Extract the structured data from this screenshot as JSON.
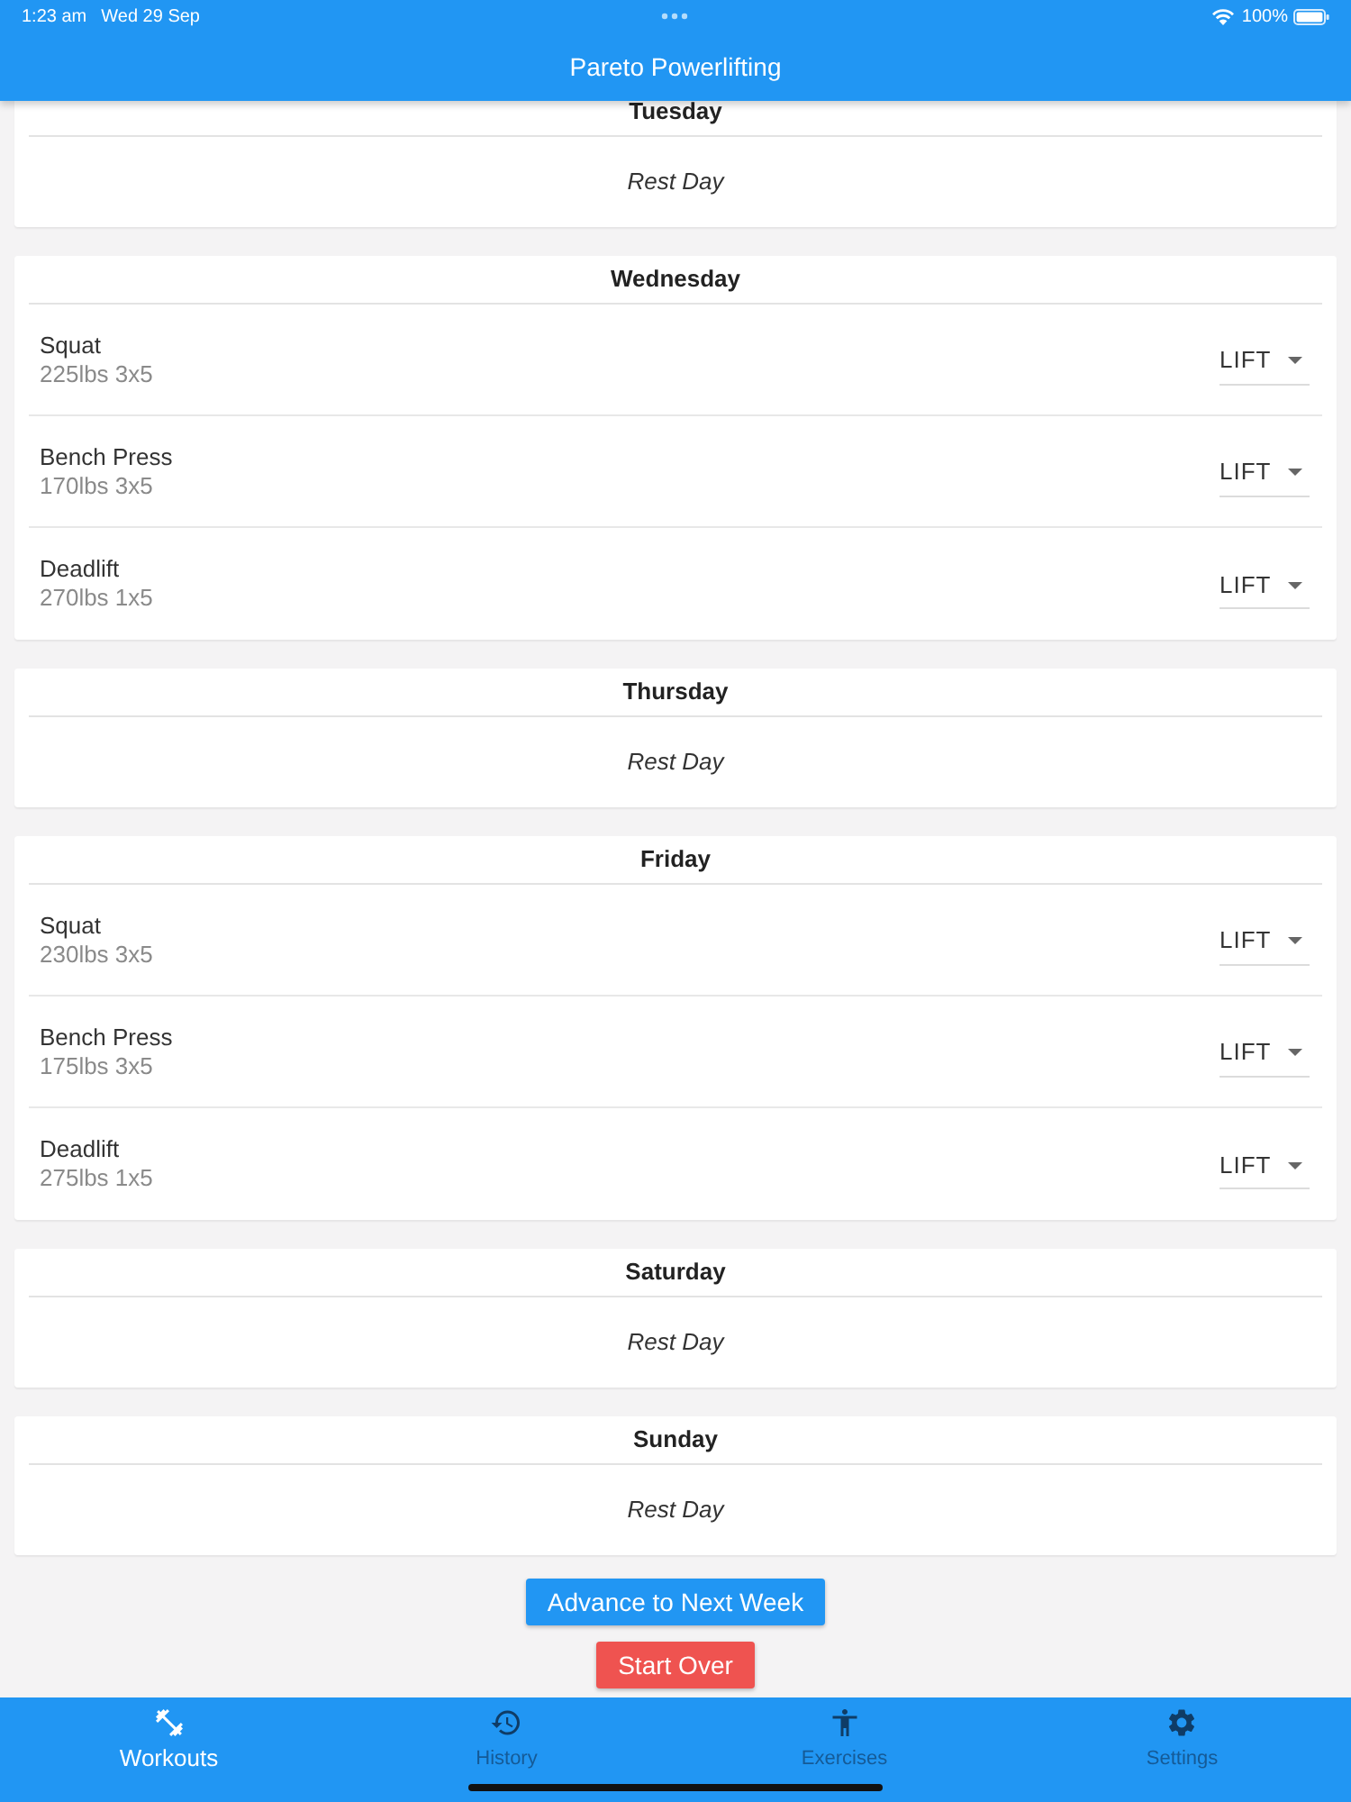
{
  "status_bar": {
    "time": "1:23 am",
    "date": "Wed 29 Sep",
    "battery": "100%"
  },
  "app_bar": {
    "title": "Pareto Powerlifting"
  },
  "days": [
    {
      "name": "Tuesday",
      "kind": "rest",
      "note": "Rest Day"
    },
    {
      "name": "Wednesday",
      "kind": "lifts",
      "exercises": [
        {
          "name": "Squat",
          "detail": "225lbs 3x5",
          "dropdown": "LIFT"
        },
        {
          "name": "Bench Press",
          "detail": "170lbs 3x5",
          "dropdown": "LIFT"
        },
        {
          "name": "Deadlift",
          "detail": "270lbs 1x5",
          "dropdown": "LIFT"
        }
      ]
    },
    {
      "name": "Thursday",
      "kind": "rest",
      "note": "Rest Day"
    },
    {
      "name": "Friday",
      "kind": "lifts",
      "exercises": [
        {
          "name": "Squat",
          "detail": "230lbs 3x5",
          "dropdown": "LIFT"
        },
        {
          "name": "Bench Press",
          "detail": "175lbs 3x5",
          "dropdown": "LIFT"
        },
        {
          "name": "Deadlift",
          "detail": "275lbs 1x5",
          "dropdown": "LIFT"
        }
      ]
    },
    {
      "name": "Saturday",
      "kind": "rest",
      "note": "Rest Day"
    },
    {
      "name": "Sunday",
      "kind": "rest",
      "note": "Rest Day"
    }
  ],
  "buttons": [
    {
      "label": "Advance to Next Week",
      "kind": "primary"
    },
    {
      "label": "Start Over",
      "kind": "danger"
    }
  ],
  "tabs": [
    {
      "label": "Workouts",
      "selected": true
    },
    {
      "label": "History",
      "selected": false
    },
    {
      "label": "Exercises",
      "selected": false
    },
    {
      "label": "Settings",
      "selected": false
    }
  ]
}
